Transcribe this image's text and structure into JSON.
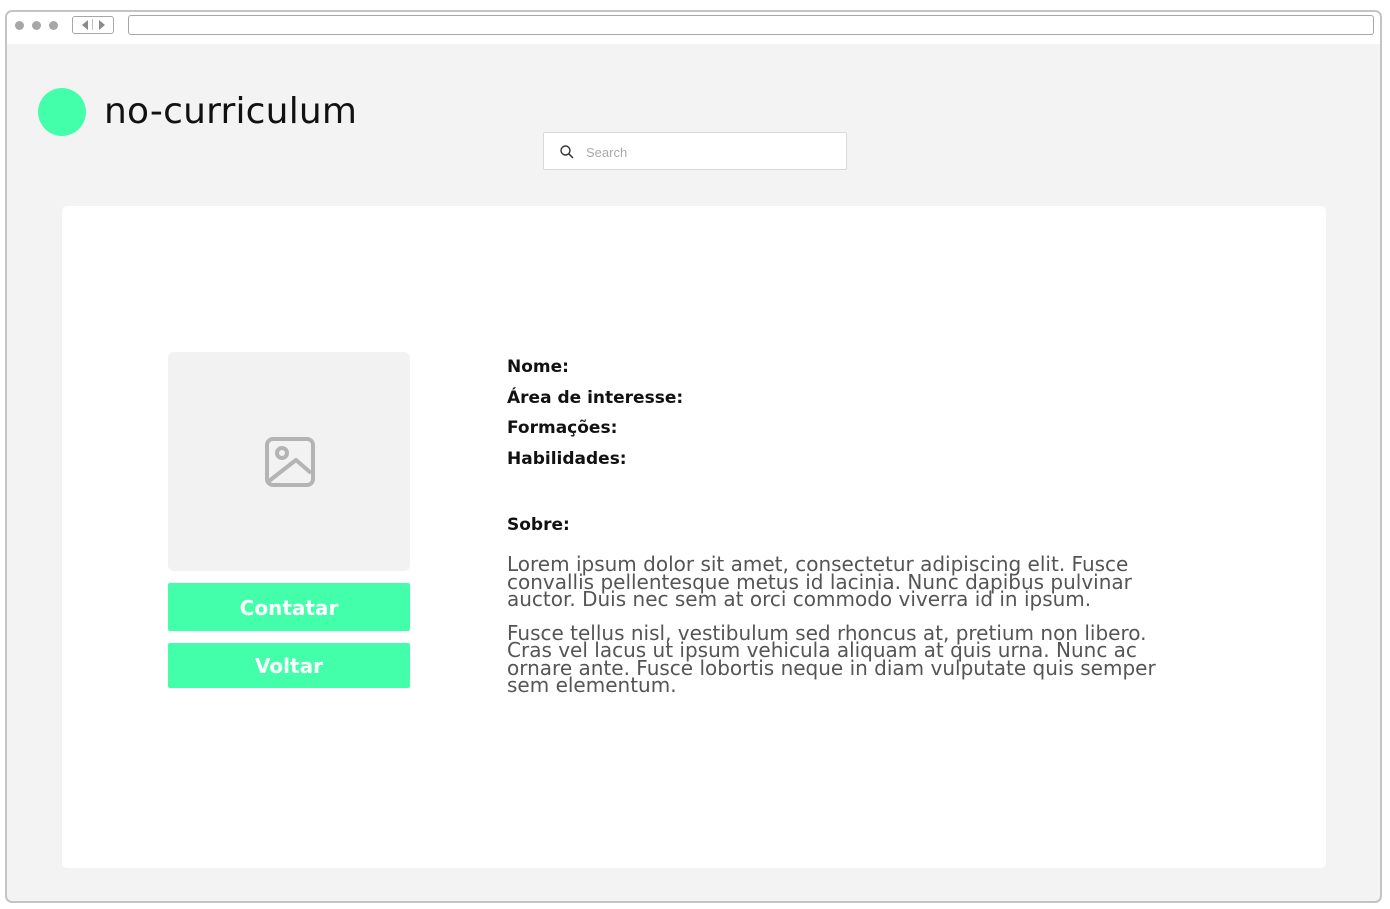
{
  "app": {
    "brand": "no-curriculum",
    "accent_color": "#43ffaa"
  },
  "search": {
    "placeholder": "Search",
    "icon": "search-icon"
  },
  "profile": {
    "photo_icon": "image-placeholder-icon",
    "buttons": {
      "contact": "Contatar",
      "back": "Voltar"
    },
    "fields": [
      {
        "label": "Nome:"
      },
      {
        "label": "Área de interesse:"
      },
      {
        "label": "Formações:"
      },
      {
        "label": "Habilidades:"
      }
    ],
    "about": {
      "label": "Sobre:",
      "paragraphs": [
        "Lorem ipsum dolor sit amet, consectetur adipiscing elit. Fusce convallis pellentesque metus id lacinia. Nunc dapibus pulvinar auctor. Duis nec sem at orci commodo viverra id in ipsum.",
        "Fusce tellus nisl, vestibulum sed rhoncus at, pretium non libero. Cras vel lacus ut ipsum vehicula aliquam at quis urna. Nunc ac ornare ante. Fusce lobortis neque in diam vulputate quis semper sem elementum."
      ]
    }
  }
}
